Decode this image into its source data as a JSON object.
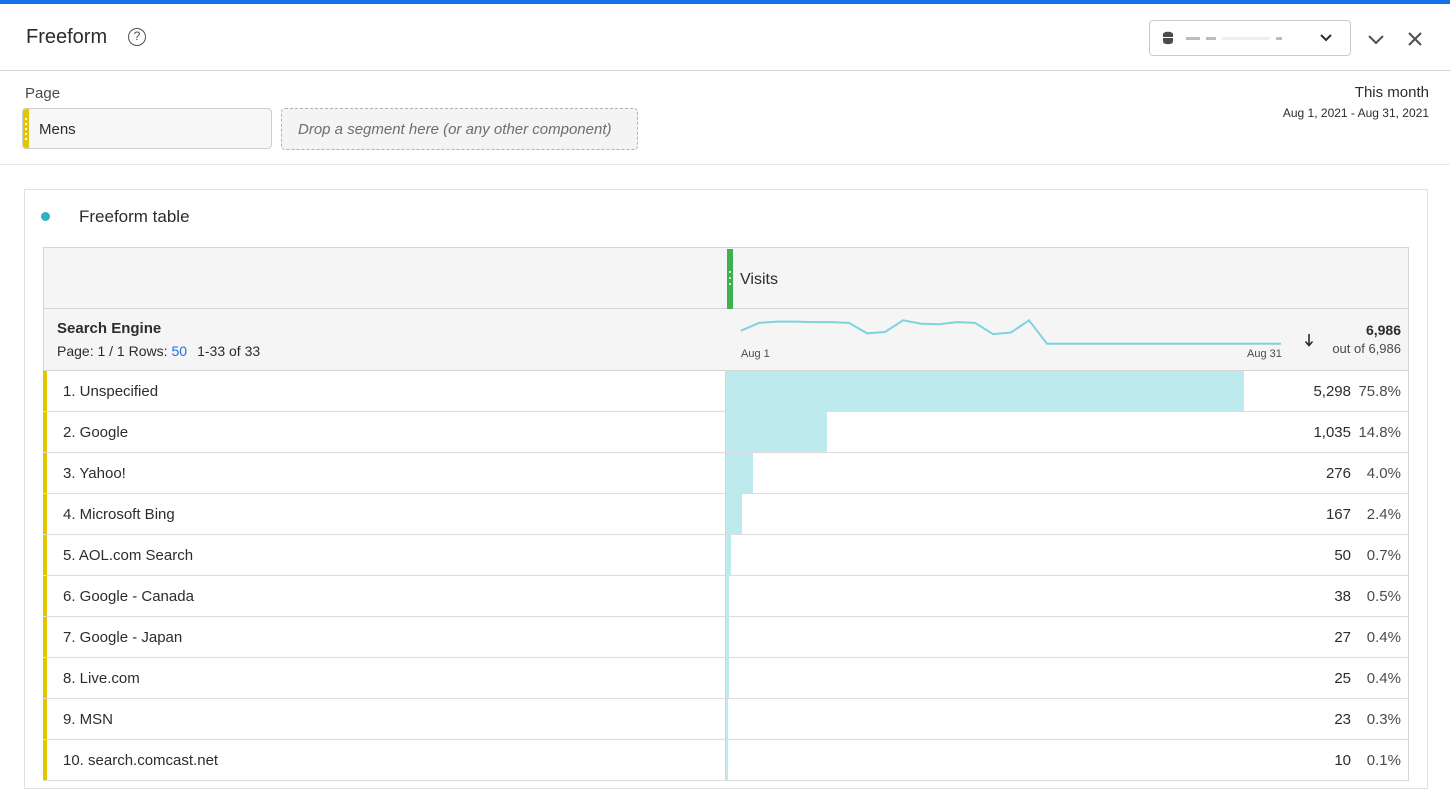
{
  "header": {
    "title": "Freeform",
    "help_glyph": "?",
    "data_source_label": "",
    "icons": [
      "help-icon",
      "database-icon",
      "chevron-down-icon",
      "collapse-chevron-icon",
      "close-icon"
    ]
  },
  "segments": {
    "page_label": "Page",
    "chips": [
      {
        "label": "Mens",
        "color": "#e3c500"
      }
    ],
    "drop_zone_placeholder": "Drop a segment here (or any other component)",
    "date_preset": "This month",
    "date_range": "Aug 1, 2021 - Aug 31, 2021"
  },
  "panel": {
    "title": "Freeform table",
    "dot_color": "#2db2c4"
  },
  "table": {
    "metric": {
      "name": "Visits",
      "color": "#3db14f"
    },
    "dimension": {
      "name": "Search Engine"
    },
    "pager": {
      "page_text": "Page: 1 / 1 Rows:",
      "rows_per_page": "50",
      "range_text": "1-33 of 33"
    },
    "sparkline": {
      "start_label": "Aug 1",
      "end_label": "Aug 31",
      "color": "#7fd3dc",
      "values": [
        0.55,
        0.85,
        0.9,
        0.9,
        0.88,
        0.88,
        0.85,
        0.45,
        0.5,
        0.95,
        0.82,
        0.8,
        0.88,
        0.85,
        0.42,
        0.48,
        0.95,
        0.05,
        0.05,
        0.05,
        0.05,
        0.05,
        0.05,
        0.05,
        0.05,
        0.05,
        0.05,
        0.05,
        0.05,
        0.05,
        0.05
      ]
    },
    "sort_icon": "sort-descending-icon",
    "total": {
      "value": "6,986",
      "sub": "out of 6,986"
    },
    "rows": [
      {
        "label": "1. Unspecified",
        "value": "5,298",
        "pct": "75.8%",
        "fraction": 0.758
      },
      {
        "label": "2. Google",
        "value": "1,035",
        "pct": "14.8%",
        "fraction": 0.148
      },
      {
        "label": "3. Yahoo!",
        "value": "276",
        "pct": "4.0%",
        "fraction": 0.04
      },
      {
        "label": "4. Microsoft Bing",
        "value": "167",
        "pct": "2.4%",
        "fraction": 0.024
      },
      {
        "label": "5. AOL.com Search",
        "value": "50",
        "pct": "0.7%",
        "fraction": 0.007
      },
      {
        "label": "6. Google - Canada",
        "value": "38",
        "pct": "0.5%",
        "fraction": 0.005
      },
      {
        "label": "7. Google - Japan",
        "value": "27",
        "pct": "0.4%",
        "fraction": 0.004
      },
      {
        "label": "8. Live.com",
        "value": "25",
        "pct": "0.4%",
        "fraction": 0.004
      },
      {
        "label": "9. MSN",
        "value": "23",
        "pct": "0.3%",
        "fraction": 0.003
      },
      {
        "label": "10. search.comcast.net",
        "value": "10",
        "pct": "0.1%",
        "fraction": 0.001
      }
    ]
  }
}
